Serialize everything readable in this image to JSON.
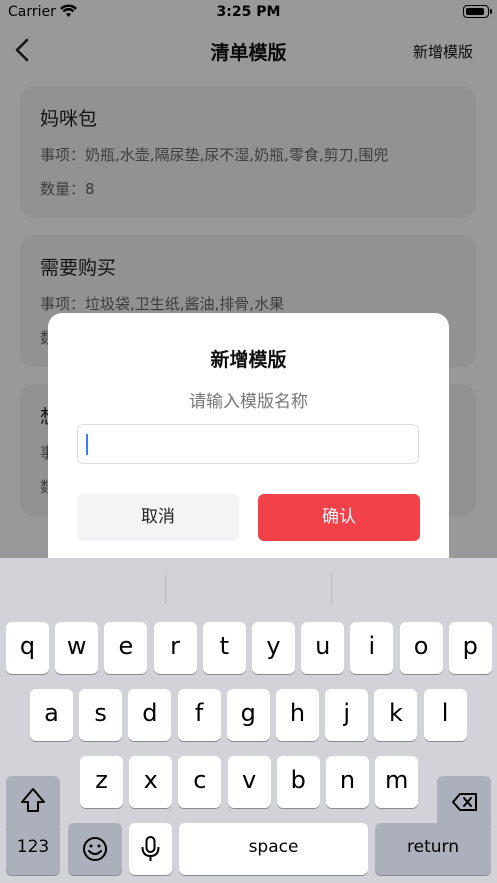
{
  "status_bar": {
    "carrier": "Carrier",
    "time": "3:25 PM",
    "battery_level": 1.0
  },
  "nav": {
    "title": "清单模版",
    "add_label": "新增模版"
  },
  "cards": [
    {
      "title": "妈咪包",
      "items": "事项：奶瓶,水壶,隔尿垫,尿不湿,奶瓶,零食,剪刀,围兜",
      "count": "数量：8"
    },
    {
      "title": "需要购买",
      "items": "事项：垃圾袋,卫生纸,酱油,排骨,水果",
      "count": "数"
    },
    {
      "title": "想",
      "items": "事",
      "count": "数"
    }
  ],
  "dialog": {
    "title": "新增模版",
    "subtitle": "请输入模版名称",
    "input_value": "",
    "cancel_label": "取消",
    "confirm_label": "确认"
  },
  "keyboard": {
    "row1": [
      "q",
      "w",
      "e",
      "r",
      "t",
      "y",
      "u",
      "i",
      "o",
      "p"
    ],
    "row2": [
      "a",
      "s",
      "d",
      "f",
      "g",
      "h",
      "j",
      "k",
      "l"
    ],
    "row3": [
      "z",
      "x",
      "c",
      "v",
      "b",
      "n",
      "m"
    ],
    "numbers_label": "123",
    "space_label": "space",
    "return_label": "return"
  },
  "colors": {
    "accent": "#f3414a",
    "card_bg": "#f4f4f6",
    "keyboard_bg": "#d1d3d9"
  }
}
